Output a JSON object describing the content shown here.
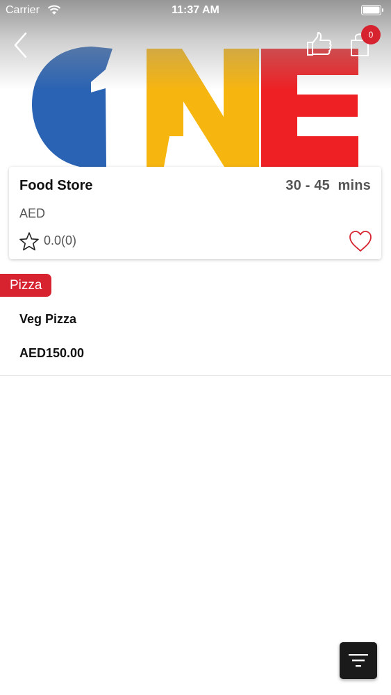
{
  "status_bar": {
    "carrier": "Carrier",
    "time": "11:37 AM"
  },
  "nav": {
    "cart_count": "0"
  },
  "store": {
    "name": "Food Store",
    "delivery_time": "30 - 45  mins",
    "currency": "AED",
    "rating": "0.0(0)"
  },
  "menu": {
    "category": "Pizza",
    "items": [
      {
        "name": "Veg Pizza",
        "price": "AED150.00"
      }
    ]
  },
  "colors": {
    "accent": "#d6232f",
    "logo_blue": "#2a63b3",
    "logo_yellow": "#f7b50f",
    "logo_red": "#ee2024",
    "fab": "#1a1a1a"
  },
  "icons": [
    "back-arrow-icon",
    "thumbs-up-icon",
    "shopping-bag-icon",
    "star-icon",
    "heart-icon",
    "filter-icon",
    "wifi-icon",
    "battery-icon"
  ]
}
